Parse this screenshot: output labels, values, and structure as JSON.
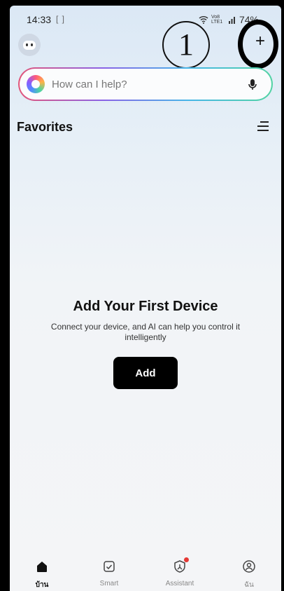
{
  "status_bar": {
    "time": "14:33",
    "time_extra": "[ ]",
    "network_label": "Vo8 LTE1",
    "battery": "74%"
  },
  "annotation": {
    "step_number": "1"
  },
  "header": {
    "add_symbol": "+"
  },
  "search": {
    "placeholder": "How can I help?"
  },
  "favorites": {
    "title": "Favorites"
  },
  "empty_state": {
    "title": "Add Your First Device",
    "description": "Connect your device, and AI can help you control it intelligently",
    "button_label": "Add"
  },
  "bottom_nav": {
    "items": [
      {
        "label": "บ้าน",
        "icon": "home-icon",
        "active": true
      },
      {
        "label": "Smart",
        "icon": "smart-checkbox-icon",
        "active": false
      },
      {
        "label": "Assistant",
        "icon": "assistant-icon",
        "active": false
      },
      {
        "label": "ฉัน",
        "icon": "profile-icon",
        "active": false
      }
    ]
  },
  "colors": {
    "primary_button": "#000000",
    "badge": "#e53935"
  }
}
